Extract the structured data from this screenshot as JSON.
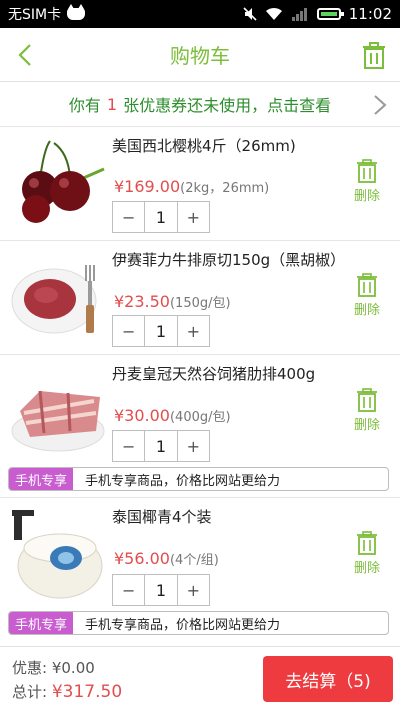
{
  "status_bar": {
    "carrier": "无SIM卡",
    "time": "11:02"
  },
  "header": {
    "title": "购物车"
  },
  "coupon": {
    "prefix": "你有",
    "count": "1",
    "suffix": "张优惠券还未使用，点击查看"
  },
  "items": [
    {
      "name": "美国西北樱桃4斤（26mm)",
      "price": "¥169.00",
      "spec": "(2kg，26mm)",
      "qty": "1",
      "minus": "−",
      "plus": "+",
      "delete_label": "删除",
      "thumb_icon": "cherries"
    },
    {
      "name": "伊赛菲力牛排原切150g（黑胡椒）",
      "price": "¥23.50",
      "spec": "(150g/包)",
      "qty": "1",
      "minus": "−",
      "plus": "+",
      "delete_label": "删除",
      "thumb_icon": "steak"
    },
    {
      "name": "丹麦皇冠天然谷饲猪肋排400g",
      "price": "¥30.00",
      "spec": "(400g/包)",
      "qty": "1",
      "minus": "−",
      "plus": "+",
      "delete_label": "删除",
      "thumb_icon": "pork-ribs",
      "promo_tag": "手机专享",
      "promo_text": "手机专享商品，价格比网站更给力"
    },
    {
      "name": "泰国椰青4个装",
      "price": "¥56.00",
      "spec": "(4个/组)",
      "qty": "1",
      "minus": "−",
      "plus": "+",
      "delete_label": "删除",
      "thumb_icon": "coconut",
      "promo_tag": "手机专享",
      "promo_text": "手机专享商品，价格比网站更给力"
    }
  ],
  "footer": {
    "discount_label": "优惠:",
    "discount_value": "¥0.00",
    "total_label": "总计:",
    "total_value": "¥317.50",
    "checkout_label": "去结算（5)"
  },
  "colors": {
    "accent_green": "#7cbd3a",
    "price_red": "#e24e4e",
    "checkout_red": "#ee3b3f",
    "promo_purple": "#c95dd0"
  }
}
